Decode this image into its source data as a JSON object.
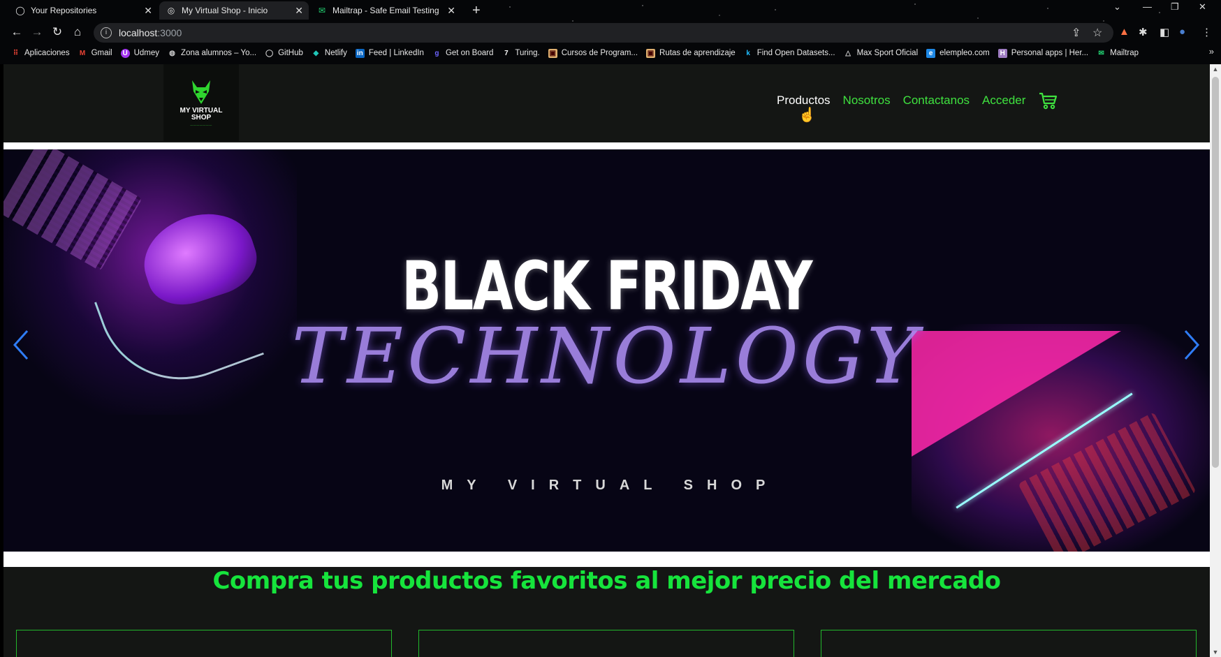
{
  "browser": {
    "tabs": [
      {
        "title": "Your Repositories",
        "icon": "github-icon"
      },
      {
        "title": "My Virtual Shop - Inicio",
        "icon": "globe-icon"
      },
      {
        "title": "Mailtrap - Safe Email Testing",
        "icon": "mailtrap-icon"
      }
    ],
    "url_host": "localhost",
    "url_port": ":3000",
    "bookmarks": [
      {
        "label": "Aplicaciones",
        "icon": "apps-grid-icon",
        "color": "#ea4335"
      },
      {
        "label": "Gmail",
        "icon": "gmail-icon",
        "color": "#ea4335"
      },
      {
        "label": "Udmey",
        "icon": "udemy-icon",
        "color": "#a435f0"
      },
      {
        "label": "Zona alumnos – Yo...",
        "icon": "globe-icon",
        "color": "#cccccc"
      },
      {
        "label": "GitHub",
        "icon": "github-icon",
        "color": "#cccccc"
      },
      {
        "label": "Netlify",
        "icon": "netlify-icon",
        "color": "#20c6b7"
      },
      {
        "label": "Feed | LinkedIn",
        "icon": "linkedin-icon",
        "color": "#0a66c2"
      },
      {
        "label": "Get on Board",
        "icon": "getonboard-icon",
        "color": "#6c63ff"
      },
      {
        "label": "Turing.",
        "icon": "turing-icon",
        "color": "#ffffff"
      },
      {
        "label": "Cursos de Program...",
        "icon": "courses-icon",
        "color": "#e0b070"
      },
      {
        "label": "Rutas de aprendizaje",
        "icon": "routes-icon",
        "color": "#e0b070"
      },
      {
        "label": "Find Open Datasets...",
        "icon": "kaggle-icon",
        "color": "#20beff"
      },
      {
        "label": "Max Sport Oficial",
        "icon": "maxsport-icon",
        "color": "#cccccc"
      },
      {
        "label": "elempleo.com",
        "icon": "elempleo-icon",
        "color": "#1e88e5"
      },
      {
        "label": "Personal apps | Her...",
        "icon": "heroku-icon",
        "color": "#9e7cc1"
      },
      {
        "label": "Mailtrap",
        "icon": "mailtrap-icon",
        "color": "#22d172"
      }
    ]
  },
  "header": {
    "logo_text_line1": "MY VIRTUAL",
    "logo_text_line2": "SHOP",
    "nav": {
      "productos": "Productos",
      "nosotros": "Nosotros",
      "contactanos": "Contactanos",
      "acceder": "Acceder"
    },
    "accent_color": "#3fe23f"
  },
  "hero": {
    "line1": "BLACK FRIDAY",
    "line2": "TECHNOLOGY",
    "line3": "MY VIRTUAL SHOP"
  },
  "section": {
    "heading": "Compra tus productos favoritos al mejor precio del mercado",
    "heading_color": "#16e43c"
  }
}
